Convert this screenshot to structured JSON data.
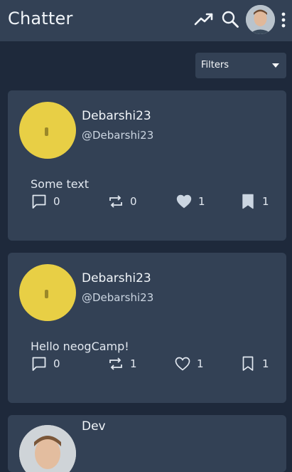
{
  "app": {
    "title": "Chatter"
  },
  "filters": {
    "label": "Filters"
  },
  "posts": [
    {
      "name": "Debarshi23",
      "handle": "@Debarshi23",
      "text": "Some text",
      "comments": "0",
      "retweets": "0",
      "likes": "1",
      "bookmarks": "1",
      "liked": true,
      "bookmarked": true
    },
    {
      "name": "Debarshi23",
      "handle": "@Debarshi23",
      "text": "Hello neogCamp!",
      "comments": "0",
      "retweets": "1",
      "likes": "1",
      "bookmarks": "1",
      "liked": false,
      "bookmarked": false
    },
    {
      "name": "Dev"
    }
  ],
  "icons": {
    "trending": "trending-up-icon",
    "search": "search-icon",
    "more": "more-vertical-icon",
    "comment": "comment-icon",
    "retweet": "retweet-icon",
    "like": "heart-icon",
    "bookmark": "bookmark-icon",
    "filter_caret": "caret-down-icon"
  },
  "colors": {
    "background": "#1e293b",
    "surface": "#334155",
    "avatar_placeholder": "#e8cf45",
    "text": "#e2e8f0"
  }
}
